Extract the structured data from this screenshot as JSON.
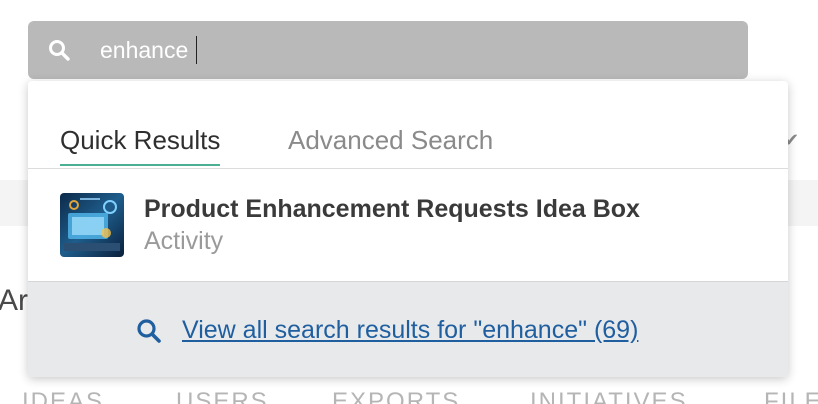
{
  "search": {
    "value": "enhance",
    "placeholder": ""
  },
  "tabs": [
    {
      "label": "Quick Results",
      "active": true
    },
    {
      "label": "Advanced Search",
      "active": false
    }
  ],
  "results": [
    {
      "title": "Product Enhancement Requests Idea Box",
      "type": "Activity"
    }
  ],
  "footer": {
    "view_all_label": "View all search results for \"enhance\" (69)"
  },
  "background": {
    "heading_fragment": "Ar",
    "nav_items": [
      "IDEAS",
      "USERS",
      "EXPORTS",
      "INITIATIVES",
      "FILE"
    ]
  },
  "colors": {
    "search_bar_bg": "#b9b9b9",
    "active_tab_underline": "#4caf93",
    "link_blue": "#1f5fa0",
    "footer_bg": "#e8e9eb"
  }
}
